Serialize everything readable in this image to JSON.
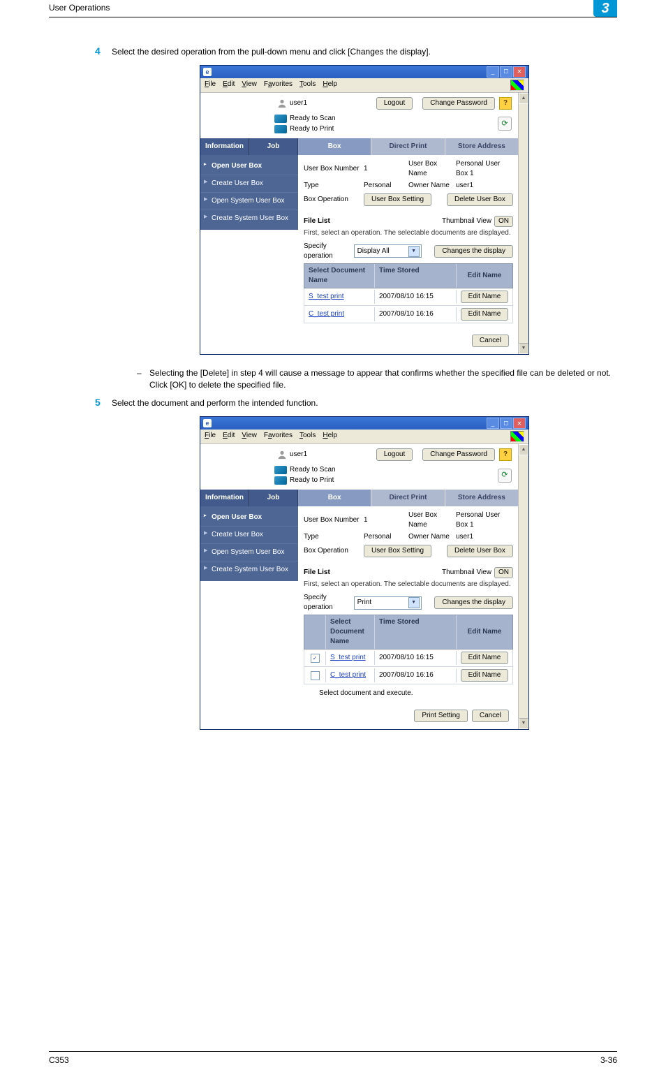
{
  "header": {
    "section": "User Operations",
    "badge": "3"
  },
  "footer": {
    "left": "C353",
    "right": "3-36"
  },
  "steps": {
    "s4": {
      "num": "4",
      "text": "Select the desired operation from the pull-down menu and click [Changes the display].",
      "bullet": "Selecting the [Delete] in step 4 will cause a message to appear that confirms whether the specified file can be deleted or not. Click [OK] to delete the specified file."
    },
    "s5": {
      "num": "5",
      "text": "Select the document and perform the intended function."
    }
  },
  "browser": {
    "menus": {
      "file": "File",
      "edit": "Edit",
      "view": "View",
      "favorites": "Favorites",
      "tools": "Tools",
      "help": "Help"
    },
    "scroll_up": "▲",
    "scroll_down": "▼"
  },
  "common_ui": {
    "user": "user1",
    "logout": "Logout",
    "change_pw": "Change Password",
    "help": "?",
    "scan": "Ready to Scan",
    "print": "Ready to Print",
    "refresh": "⟳",
    "left_tabs": {
      "info": "Information",
      "job": "Job"
    },
    "right_tabs": {
      "box": "Box",
      "direct": "Direct Print",
      "store": "Store Address"
    },
    "left_menu": {
      "open_user": "Open User Box",
      "create_user": "Create User Box",
      "open_sys": "Open System User Box",
      "create_sys": "Create System User Box"
    },
    "details": {
      "ubn_lab": "User Box Number",
      "ubn_val": "1",
      "ubname_lab": "User Box Name",
      "ubname_val": "Personal User Box 1",
      "type_lab": "Type",
      "type_val": "Personal",
      "owner_lab": "Owner Name",
      "owner_val": "user1",
      "boxop": "Box Operation",
      "ubset": "User Box Setting",
      "delub": "Delete User Box"
    },
    "file_list": {
      "title": "File List",
      "thumb": "Thumbnail View",
      "on": "ON",
      "instruct": "First, select an operation. The selectable documents are displayed.",
      "spec_lab": "Specify operation",
      "change": "Changes the display",
      "col_sel": "Select",
      "col_name": "Document Name",
      "col_time": "Time Stored",
      "col_edit": "Edit Name",
      "edit_btn": "Edit Name",
      "rows": [
        {
          "name": "S_test print",
          "time": "2007/08/10 16:15"
        },
        {
          "name": "C_test print",
          "time": "2007/08/10 16:16"
        }
      ],
      "cancel": "Cancel",
      "print_setting": "Print Setting",
      "select_note": "Select document and execute."
    }
  },
  "shotA": {
    "spec_value": "Display All"
  },
  "shotB": {
    "spec_value": "Print",
    "row0_checked": true,
    "row1_checked": false
  }
}
